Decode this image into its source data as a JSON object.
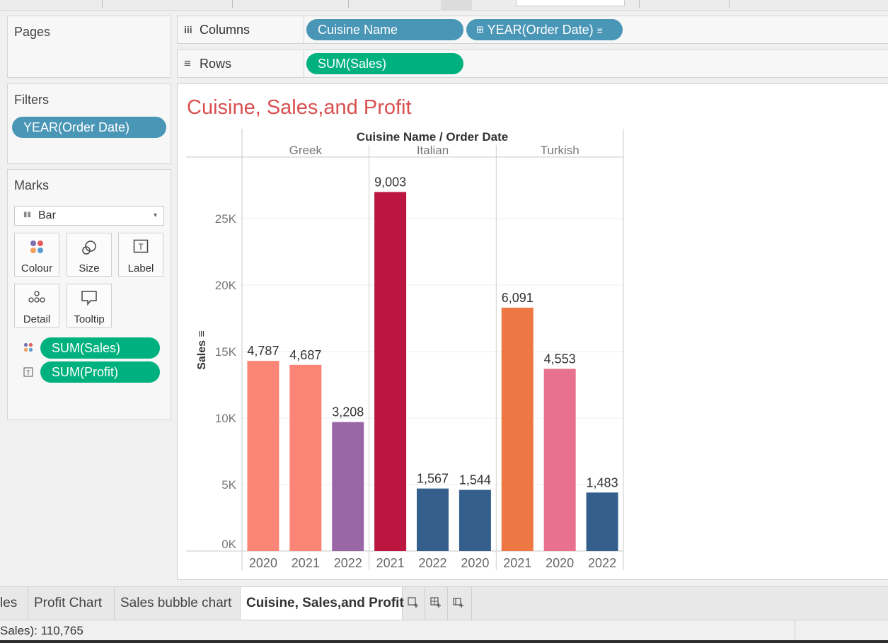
{
  "shelves": {
    "pages_label": "Pages",
    "columns_label": "Columns",
    "rows_label": "Rows",
    "columns_pills": [
      "Cuisine Name",
      "YEAR(Order Date)"
    ],
    "rows_pills": [
      "SUM(Sales)"
    ]
  },
  "filters": {
    "title": "Filters",
    "pills": [
      "YEAR(Order Date)"
    ]
  },
  "marks": {
    "title": "Marks",
    "mark_type": "Bar",
    "buttons": [
      "Colour",
      "Size",
      "Label",
      "Detail",
      "Tooltip"
    ],
    "pills": [
      "SUM(Sales)",
      "SUM(Profit)"
    ]
  },
  "sheet_title": "Cuisine, Sales,and Profit",
  "colors": {
    "title": "#d94f4f",
    "blue_pill": "#4a96b6",
    "green_pill": "#00b180"
  },
  "chart_data": {
    "type": "bar",
    "title": "Cuisine, Sales,and Profit",
    "header_label": "Cuisine Name  /  Order Date",
    "ylabel": "Sales",
    "ylim": [
      0,
      30000
    ],
    "yticks": [
      0,
      5000,
      10000,
      15000,
      20000,
      25000
    ],
    "ytick_labels": [
      "0K",
      "5K",
      "10K",
      "15K",
      "20K",
      "25K"
    ],
    "groups": [
      {
        "name": "Greek",
        "bars": [
          {
            "year": "2020",
            "sales": 14300,
            "label": "4,787",
            "color": "#fb8677"
          },
          {
            "year": "2021",
            "sales": 14000,
            "label": "4,687",
            "color": "#fb8677"
          },
          {
            "year": "2022",
            "sales": 9700,
            "label": "3,208",
            "color": "#9a67a6"
          }
        ]
      },
      {
        "name": "Italian",
        "bars": [
          {
            "year": "2021",
            "sales": 27000,
            "label": "9,003",
            "color": "#ba1640"
          },
          {
            "year": "2022",
            "sales": 4700,
            "label": "1,567",
            "color": "#345f8c"
          },
          {
            "year": "2020",
            "sales": 4600,
            "label": "1,544",
            "color": "#345f8c"
          }
        ]
      },
      {
        "name": "Turkish",
        "bars": [
          {
            "year": "2021",
            "sales": 18300,
            "label": "6,091",
            "color": "#ee7744"
          },
          {
            "year": "2020",
            "sales": 13700,
            "label": "4,553",
            "color": "#e7718e"
          },
          {
            "year": "2022",
            "sales": 4400,
            "label": "1,483",
            "color": "#345f8c"
          }
        ]
      }
    ]
  },
  "tabs": [
    "les",
    "Profit Chart",
    "Sales bubble chart",
    "Cuisine, Sales,and Profit"
  ],
  "active_tab": "Cuisine, Sales,and Profit",
  "status": "Sales): 110,765"
}
